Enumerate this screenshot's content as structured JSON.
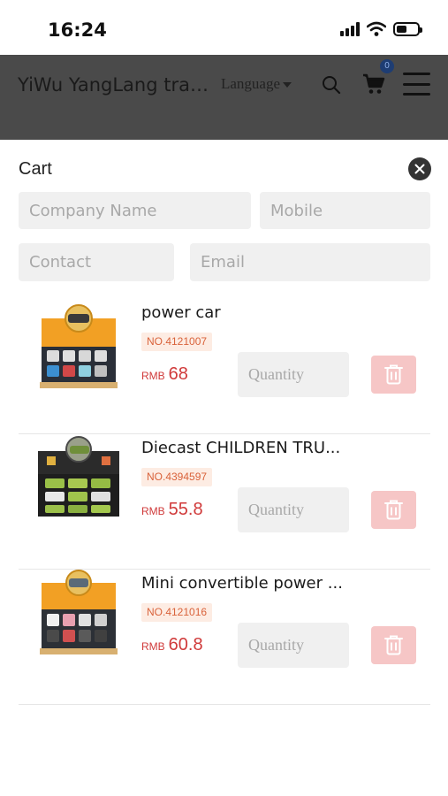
{
  "status_bar": {
    "time": "16:24"
  },
  "header": {
    "site_title": "YiWu YangLang trad...",
    "language_label": "Language",
    "cart_count": "0"
  },
  "cart": {
    "title": "Cart",
    "fields": {
      "company_placeholder": "Company Name",
      "mobile_placeholder": "Mobile",
      "contact_placeholder": "Contact",
      "email_placeholder": "Email"
    },
    "quantity_placeholder": "Quantity",
    "currency": "RMB",
    "items": [
      {
        "name": "power car",
        "code": "NO.4121007",
        "price": "68"
      },
      {
        "name": "Diecast CHILDREN TRU...",
        "code": "NO.4394597",
        "price": "55.8"
      },
      {
        "name": "Mini convertible power ...",
        "code": "NO.4121016",
        "price": "60.8"
      }
    ]
  },
  "colors": {
    "accent_price": "#d03a3a",
    "code_badge_bg": "#fdece3",
    "delete_bg": "#f6c6c6",
    "header_overlay": "#4a4a4a"
  },
  "icons": [
    "signal-icon",
    "wifi-icon",
    "battery-icon",
    "search-icon",
    "cart-icon",
    "menu-icon",
    "close-icon",
    "trash-icon"
  ]
}
